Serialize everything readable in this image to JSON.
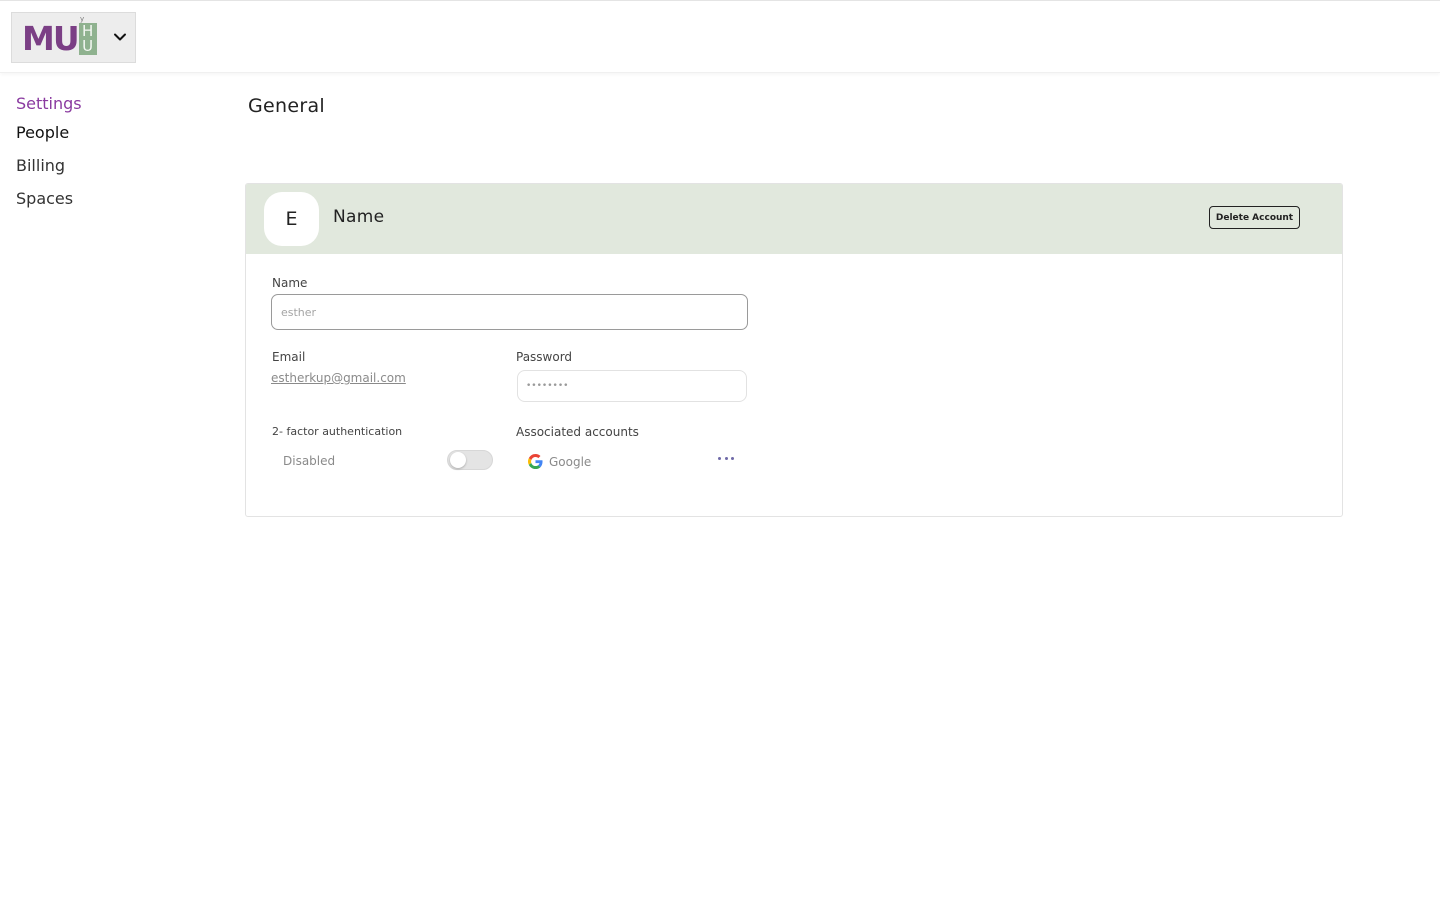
{
  "topbar": {
    "logo_text": "MU",
    "logo_box_letters": [
      "H",
      "U"
    ],
    "logo_mark": "y",
    "switcher_icon": "chevron-down-icon"
  },
  "sidebar": {
    "items": [
      {
        "label": "Settings",
        "active": true
      },
      {
        "label": "People"
      },
      {
        "label": "Billing"
      },
      {
        "label": "Spaces"
      }
    ]
  },
  "main": {
    "title": "General",
    "profile": {
      "avatar_initial": "E",
      "header_name": "Name",
      "delete_label": "Delete Account",
      "name_label": "Name",
      "name_placeholder": "esther",
      "email_label": "Email",
      "email_value": "estherkup@gmail.com",
      "password_label": "Password",
      "password_placeholder": "••••••••",
      "twofa_label": "2- factor authentication",
      "twofa_status": "Disabled",
      "twofa_enabled": false,
      "associated_label": "Associated accounts",
      "associated_accounts": [
        {
          "provider": "Google",
          "icon": "google-icon"
        }
      ],
      "more_icon": "more-horizontal-icon"
    }
  },
  "colors": {
    "accent": "#8a3aa0",
    "header_bg": "#e1e8dd",
    "logo_purple": "#7b3f85",
    "logo_green": "#8fb28f"
  }
}
